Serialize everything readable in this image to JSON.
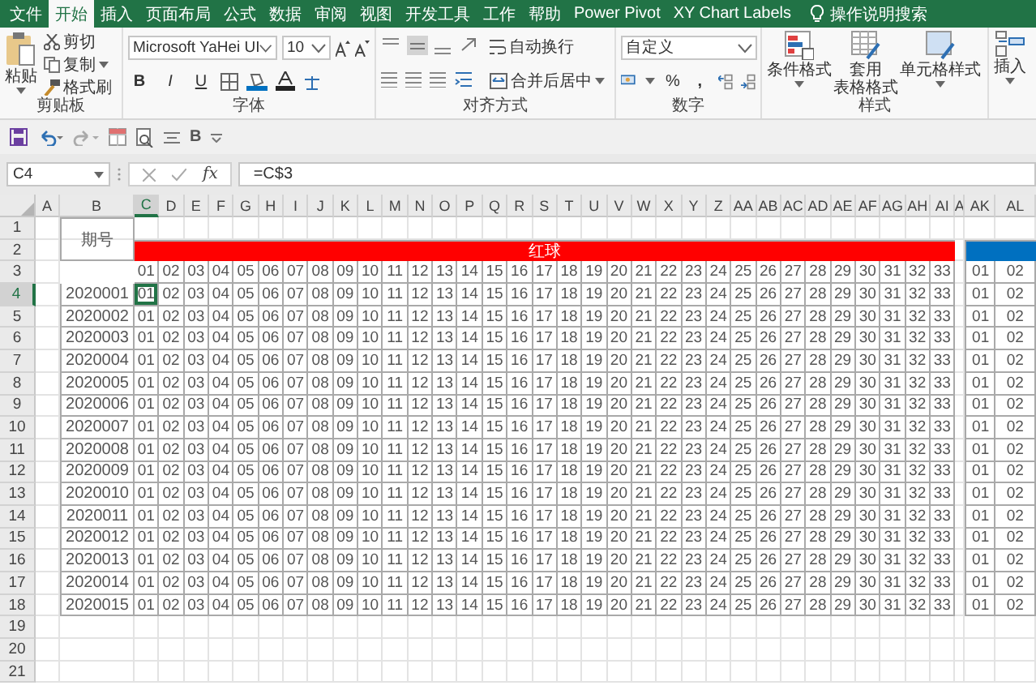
{
  "ribbon_tabs": [
    {
      "label": "文件",
      "selected": false
    },
    {
      "label": "开始",
      "selected": true
    },
    {
      "label": "插入",
      "selected": false
    },
    {
      "label": "页面布局",
      "selected": false
    },
    {
      "label": "公式",
      "selected": false
    },
    {
      "label": "数据",
      "selected": false
    },
    {
      "label": "审阅",
      "selected": false
    },
    {
      "label": "视图",
      "selected": false
    },
    {
      "label": "开发工具",
      "selected": false
    },
    {
      "label": "工作",
      "selected": false
    },
    {
      "label": "帮助",
      "selected": false
    },
    {
      "label": "Power Pivot",
      "selected": false
    },
    {
      "label": "XY Chart Labels",
      "selected": false
    }
  ],
  "tell_me": "操作说明搜索",
  "clipboard": {
    "paste": "粘贴",
    "cut": "剪切",
    "copy": "复制",
    "format_painter": "格式刷",
    "label": "剪贴板"
  },
  "font": {
    "name": "Microsoft YaHei UI",
    "size": "10",
    "bold": "B",
    "italic": "I",
    "underline": "U",
    "label": "字体"
  },
  "alignment": {
    "wrap": "自动换行",
    "merge": "合并后居中",
    "label": "对齐方式"
  },
  "number": {
    "format": "自定义",
    "percent": "%",
    "comma": ",",
    "label": "数字"
  },
  "styles": {
    "conditional": "条件格式",
    "table_format": [
      "套用",
      "表格格式"
    ],
    "cell_styles": "单元格样式",
    "label": "样式"
  },
  "cells": {
    "insert": "插入"
  },
  "quick_access": {
    "bold": "B"
  },
  "formula_bar": {
    "name_box": "C4",
    "function_label": "fx",
    "formula": "=C$3"
  },
  "sheet": {
    "columns": [
      {
        "label": "A",
        "selected": false
      },
      {
        "label": "B",
        "selected": false
      },
      {
        "label": "C",
        "selected": true
      },
      {
        "label": "D",
        "selected": false
      },
      {
        "label": "E",
        "selected": false
      },
      {
        "label": "F",
        "selected": false
      },
      {
        "label": "G",
        "selected": false
      },
      {
        "label": "H",
        "selected": false
      },
      {
        "label": "I",
        "selected": false
      },
      {
        "label": "J",
        "selected": false
      },
      {
        "label": "K",
        "selected": false
      },
      {
        "label": "L",
        "selected": false
      },
      {
        "label": "M",
        "selected": false
      },
      {
        "label": "N",
        "selected": false
      },
      {
        "label": "O",
        "selected": false
      },
      {
        "label": "P",
        "selected": false
      },
      {
        "label": "Q",
        "selected": false
      },
      {
        "label": "R",
        "selected": false
      },
      {
        "label": "S",
        "selected": false
      },
      {
        "label": "T",
        "selected": false
      },
      {
        "label": "U",
        "selected": false
      },
      {
        "label": "V",
        "selected": false
      },
      {
        "label": "W",
        "selected": false
      },
      {
        "label": "X",
        "selected": false
      },
      {
        "label": "Y",
        "selected": false
      },
      {
        "label": "Z",
        "selected": false
      },
      {
        "label": "AA",
        "selected": false
      },
      {
        "label": "AB",
        "selected": false
      },
      {
        "label": "AC",
        "selected": false
      },
      {
        "label": "AD",
        "selected": false
      },
      {
        "label": "AE",
        "selected": false
      },
      {
        "label": "AF",
        "selected": false
      },
      {
        "label": "AG",
        "selected": false
      },
      {
        "label": "AH",
        "selected": false
      },
      {
        "label": "AI",
        "selected": false
      },
      {
        "label": "A",
        "selected": false
      },
      {
        "label": "AK",
        "selected": false
      },
      {
        "label": "AL",
        "selected": false
      }
    ],
    "rows": [
      {
        "label": "1",
        "selected": false
      },
      {
        "label": "2",
        "selected": false
      },
      {
        "label": "3",
        "selected": false
      },
      {
        "label": "4",
        "selected": true
      },
      {
        "label": "5",
        "selected": false
      },
      {
        "label": "6",
        "selected": false
      },
      {
        "label": "7",
        "selected": false
      },
      {
        "label": "8",
        "selected": false
      },
      {
        "label": "9",
        "selected": false
      },
      {
        "label": "10",
        "selected": false
      },
      {
        "label": "11",
        "selected": false
      },
      {
        "label": "12",
        "selected": false
      },
      {
        "label": "13",
        "selected": false
      },
      {
        "label": "14",
        "selected": false
      },
      {
        "label": "15",
        "selected": false
      },
      {
        "label": "16",
        "selected": false
      },
      {
        "label": "17",
        "selected": false
      },
      {
        "label": "18",
        "selected": false
      },
      {
        "label": "19",
        "selected": false
      },
      {
        "label": "20",
        "selected": false
      },
      {
        "label": "21",
        "selected": false
      }
    ],
    "table": {
      "period_header": "期号",
      "red_header": "红球",
      "red_numbers": [
        "01",
        "02",
        "03",
        "04",
        "05",
        "06",
        "07",
        "08",
        "09",
        "10",
        "11",
        "12",
        "13",
        "14",
        "15",
        "16",
        "17",
        "18",
        "19",
        "20",
        "21",
        "22",
        "23",
        "24",
        "25",
        "26",
        "27",
        "28",
        "29",
        "30",
        "31",
        "32",
        "33"
      ],
      "blue_numbers": [
        "01",
        "02"
      ],
      "records": [
        {
          "period": "2020001",
          "red": [
            "01",
            "02",
            "03",
            "04",
            "05",
            "06",
            "07",
            "08",
            "09",
            "10",
            "11",
            "12",
            "13",
            "14",
            "15",
            "16",
            "17",
            "18",
            "19",
            "20",
            "21",
            "22",
            "23",
            "24",
            "25",
            "26",
            "27",
            "28",
            "29",
            "30",
            "31",
            "32",
            "33"
          ],
          "blue": [
            "01",
            "02"
          ]
        },
        {
          "period": "2020002",
          "red": [
            "01",
            "02",
            "03",
            "04",
            "05",
            "06",
            "07",
            "08",
            "09",
            "10",
            "11",
            "12",
            "13",
            "14",
            "15",
            "16",
            "17",
            "18",
            "19",
            "20",
            "21",
            "22",
            "23",
            "24",
            "25",
            "26",
            "27",
            "28",
            "29",
            "30",
            "31",
            "32",
            "33"
          ],
          "blue": [
            "01",
            "02"
          ]
        },
        {
          "period": "2020003",
          "red": [
            "01",
            "02",
            "03",
            "04",
            "05",
            "06",
            "07",
            "08",
            "09",
            "10",
            "11",
            "12",
            "13",
            "14",
            "15",
            "16",
            "17",
            "18",
            "19",
            "20",
            "21",
            "22",
            "23",
            "24",
            "25",
            "26",
            "27",
            "28",
            "29",
            "30",
            "31",
            "32",
            "33"
          ],
          "blue": [
            "01",
            "02"
          ]
        },
        {
          "period": "2020004",
          "red": [
            "01",
            "02",
            "03",
            "04",
            "05",
            "06",
            "07",
            "08",
            "09",
            "10",
            "11",
            "12",
            "13",
            "14",
            "15",
            "16",
            "17",
            "18",
            "19",
            "20",
            "21",
            "22",
            "23",
            "24",
            "25",
            "26",
            "27",
            "28",
            "29",
            "30",
            "31",
            "32",
            "33"
          ],
          "blue": [
            "01",
            "02"
          ]
        },
        {
          "period": "2020005",
          "red": [
            "01",
            "02",
            "03",
            "04",
            "05",
            "06",
            "07",
            "08",
            "09",
            "10",
            "11",
            "12",
            "13",
            "14",
            "15",
            "16",
            "17",
            "18",
            "19",
            "20",
            "21",
            "22",
            "23",
            "24",
            "25",
            "26",
            "27",
            "28",
            "29",
            "30",
            "31",
            "32",
            "33"
          ],
          "blue": [
            "01",
            "02"
          ]
        },
        {
          "period": "2020006",
          "red": [
            "01",
            "02",
            "03",
            "04",
            "05",
            "06",
            "07",
            "08",
            "09",
            "10",
            "11",
            "12",
            "13",
            "14",
            "15",
            "16",
            "17",
            "18",
            "19",
            "20",
            "21",
            "22",
            "23",
            "24",
            "25",
            "26",
            "27",
            "28",
            "29",
            "30",
            "31",
            "32",
            "33"
          ],
          "blue": [
            "01",
            "02"
          ]
        },
        {
          "period": "2020007",
          "red": [
            "01",
            "02",
            "03",
            "04",
            "05",
            "06",
            "07",
            "08",
            "09",
            "10",
            "11",
            "12",
            "13",
            "14",
            "15",
            "16",
            "17",
            "18",
            "19",
            "20",
            "21",
            "22",
            "23",
            "24",
            "25",
            "26",
            "27",
            "28",
            "29",
            "30",
            "31",
            "32",
            "33"
          ],
          "blue": [
            "01",
            "02"
          ]
        },
        {
          "period": "2020008",
          "red": [
            "01",
            "02",
            "03",
            "04",
            "05",
            "06",
            "07",
            "08",
            "09",
            "10",
            "11",
            "12",
            "13",
            "14",
            "15",
            "16",
            "17",
            "18",
            "19",
            "20",
            "21",
            "22",
            "23",
            "24",
            "25",
            "26",
            "27",
            "28",
            "29",
            "30",
            "31",
            "32",
            "33"
          ],
          "blue": [
            "01",
            "02"
          ]
        },
        {
          "period": "2020009",
          "red": [
            "01",
            "02",
            "03",
            "04",
            "05",
            "06",
            "07",
            "08",
            "09",
            "10",
            "11",
            "12",
            "13",
            "14",
            "15",
            "16",
            "17",
            "18",
            "19",
            "20",
            "21",
            "22",
            "23",
            "24",
            "25",
            "26",
            "27",
            "28",
            "29",
            "30",
            "31",
            "32",
            "33"
          ],
          "blue": [
            "01",
            "02"
          ]
        },
        {
          "period": "2020010",
          "red": [
            "01",
            "02",
            "03",
            "04",
            "05",
            "06",
            "07",
            "08",
            "09",
            "10",
            "11",
            "12",
            "13",
            "14",
            "15",
            "16",
            "17",
            "18",
            "19",
            "20",
            "21",
            "22",
            "23",
            "24",
            "25",
            "26",
            "27",
            "28",
            "29",
            "30",
            "31",
            "32",
            "33"
          ],
          "blue": [
            "01",
            "02"
          ]
        },
        {
          "period": "2020011",
          "red": [
            "01",
            "02",
            "03",
            "04",
            "05",
            "06",
            "07",
            "08",
            "09",
            "10",
            "11",
            "12",
            "13",
            "14",
            "15",
            "16",
            "17",
            "18",
            "19",
            "20",
            "21",
            "22",
            "23",
            "24",
            "25",
            "26",
            "27",
            "28",
            "29",
            "30",
            "31",
            "32",
            "33"
          ],
          "blue": [
            "01",
            "02"
          ]
        },
        {
          "period": "2020012",
          "red": [
            "01",
            "02",
            "03",
            "04",
            "05",
            "06",
            "07",
            "08",
            "09",
            "10",
            "11",
            "12",
            "13",
            "14",
            "15",
            "16",
            "17",
            "18",
            "19",
            "20",
            "21",
            "22",
            "23",
            "24",
            "25",
            "26",
            "27",
            "28",
            "29",
            "30",
            "31",
            "32",
            "33"
          ],
          "blue": [
            "01",
            "02"
          ]
        },
        {
          "period": "2020013",
          "red": [
            "01",
            "02",
            "03",
            "04",
            "05",
            "06",
            "07",
            "08",
            "09",
            "10",
            "11",
            "12",
            "13",
            "14",
            "15",
            "16",
            "17",
            "18",
            "19",
            "20",
            "21",
            "22",
            "23",
            "24",
            "25",
            "26",
            "27",
            "28",
            "29",
            "30",
            "31",
            "32",
            "33"
          ],
          "blue": [
            "01",
            "02"
          ]
        },
        {
          "period": "2020014",
          "red": [
            "01",
            "02",
            "03",
            "04",
            "05",
            "06",
            "07",
            "08",
            "09",
            "10",
            "11",
            "12",
            "13",
            "14",
            "15",
            "16",
            "17",
            "18",
            "19",
            "20",
            "21",
            "22",
            "23",
            "24",
            "25",
            "26",
            "27",
            "28",
            "29",
            "30",
            "31",
            "32",
            "33"
          ],
          "blue": [
            "01",
            "02"
          ]
        },
        {
          "period": "2020015",
          "red": [
            "01",
            "02",
            "03",
            "04",
            "05",
            "06",
            "07",
            "08",
            "09",
            "10",
            "11",
            "12",
            "13",
            "14",
            "15",
            "16",
            "17",
            "18",
            "19",
            "20",
            "21",
            "22",
            "23",
            "24",
            "25",
            "26",
            "27",
            "28",
            "29",
            "30",
            "31",
            "32",
            "33"
          ],
          "blue": [
            "01",
            "02"
          ]
        }
      ]
    }
  }
}
